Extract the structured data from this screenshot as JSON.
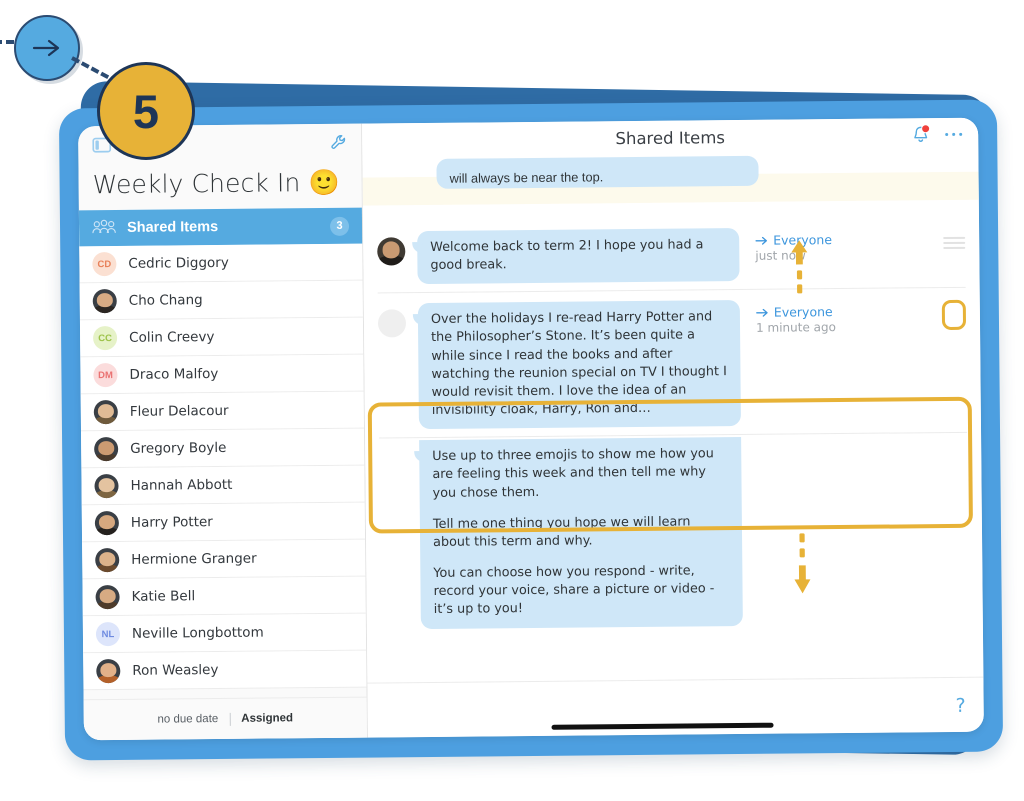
{
  "annotation": {
    "step_number": "5",
    "arrow_icon": "arrow-right-icon",
    "connector": "dashed-line"
  },
  "sidebar": {
    "toggle_icon": "panel-toggle-icon",
    "tools_icon": "wrench-icon",
    "title": "Weekly Check In 🙂",
    "shared": {
      "icon": "people-group-icon",
      "label": "Shared Items",
      "count": "3"
    },
    "members": [
      {
        "name": "Cedric Diggory",
        "initials": "CD",
        "type": "initials",
        "bg": "#fbe0d2",
        "fg": "#e8815a"
      },
      {
        "name": "Cho Chang",
        "initials": "",
        "type": "photo",
        "hair": "#2b2622",
        "skin": "#d8ab84"
      },
      {
        "name": "Colin Creevy",
        "initials": "CC",
        "type": "initials",
        "bg": "#e6f2c8",
        "fg": "#9dc34a"
      },
      {
        "name": "Draco Malfoy",
        "initials": "DM",
        "type": "initials",
        "bg": "#fbdcdc",
        "fg": "#ea7272"
      },
      {
        "name": "Fleur Delacour",
        "initials": "",
        "type": "photo",
        "hair": "#6f5a3c",
        "skin": "#e0bb95"
      },
      {
        "name": "Gregory Boyle",
        "initials": "",
        "type": "photo",
        "hair": "#4a3a2c",
        "skin": "#cc9b72"
      },
      {
        "name": "Hannah Abbott",
        "initials": "",
        "type": "photo",
        "hair": "#7d6542",
        "skin": "#e4c3a0"
      },
      {
        "name": "Harry Potter",
        "initials": "",
        "type": "photo",
        "hair": "#25211e",
        "skin": "#d6a87f"
      },
      {
        "name": "Hermione Granger",
        "initials": "",
        "type": "photo",
        "hair": "#6b4a2d",
        "skin": "#dcb28a"
      },
      {
        "name": "Katie Bell",
        "initials": "",
        "type": "photo",
        "hair": "#4e3b2a",
        "skin": "#d7ab83"
      },
      {
        "name": "Neville Longbottom",
        "initials": "NL",
        "type": "initials",
        "bg": "#dde5fb",
        "fg": "#6f8be0"
      },
      {
        "name": "Ron Weasley",
        "initials": "",
        "type": "photo",
        "hair": "#b4612a",
        "skin": "#e2b189"
      }
    ],
    "footer": {
      "due": "no due date",
      "assigned": "Assigned"
    }
  },
  "main": {
    "title": "Shared Items",
    "bell_icon": "notification-bell-icon",
    "more_icon": "more-options-icon",
    "help_icon": "help-question-icon",
    "partial_message": "will always be near the top.",
    "messages": [
      {
        "body": [
          "Welcome back to term 2! I hope you had a good break."
        ],
        "recipient": "Everyone",
        "time": "just now",
        "menu_icon": "hamburger-menu-icon",
        "highlighted": false
      },
      {
        "body": [
          "Over the holidays I re-read Harry Potter and the Philosopher’s Stone. It’s been quite a while since I read the books and after watching the reunion special on TV I thought I would revisit them. I love the idea of an invisibility cloak, Harry, Ron and…"
        ],
        "recipient": "Everyone",
        "time": "1 minute ago",
        "menu_icon": "hamburger-menu-icon",
        "highlighted": true
      },
      {
        "body": [
          "Use up to three emojis to show me how you are feeling this week and then tell me why you chose them.",
          "Tell me one thing you hope we will learn about this term and why.",
          "You can choose how you respond - write, record your voice, share a picture or video - it’s up to you!"
        ],
        "recipient": "",
        "time": "",
        "menu_icon": "",
        "highlighted": false
      }
    ],
    "scroll_up_icon": "scroll-up-arrow-icon",
    "scroll_down_icon": "scroll-down-arrow-icon"
  },
  "colors": {
    "accent_blue": "#55aae0",
    "frame_blue": "#4d9fe0",
    "frame_dark_blue": "#2f6ca5",
    "highlight_gold": "#e7b237",
    "bubble_blue": "#cfe7f8",
    "cream": "#fdfaec",
    "badge_navy": "#1d3557"
  }
}
